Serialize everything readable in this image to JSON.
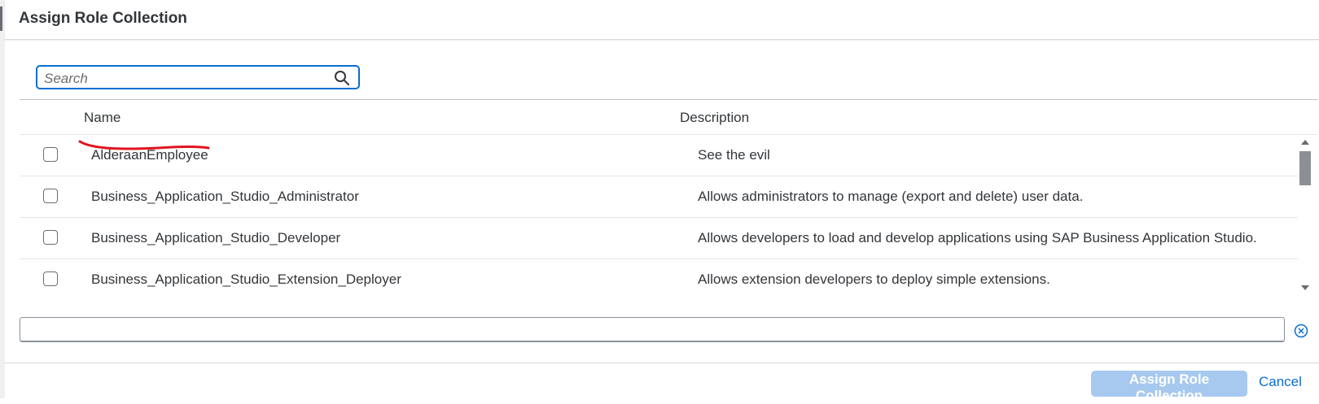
{
  "dialog": {
    "title": "Assign Role Collection"
  },
  "search": {
    "placeholder": "Search",
    "value": "",
    "icon": "search-icon"
  },
  "table": {
    "columns": [
      "Name",
      "Description"
    ],
    "rows": [
      {
        "name": "AlderaanEmployee",
        "description": "See the evil",
        "checked": false
      },
      {
        "name": "Business_Application_Studio_Administrator",
        "description": "Allows administrators to manage (export and delete) user data.",
        "checked": false
      },
      {
        "name": "Business_Application_Studio_Developer",
        "description": "Allows developers to load and develop applications using SAP Business Application Studio.",
        "checked": false
      },
      {
        "name": "Business_Application_Studio_Extension_Deployer",
        "description": "Allows extension developers to deploy simple extensions.",
        "checked": false
      }
    ]
  },
  "annotation": {
    "color": "#e0141e"
  },
  "footer": {
    "assign_label": "Assign Role Collection",
    "cancel_label": "Cancel"
  },
  "colors": {
    "accent": "#0a6ed1",
    "disabled_button": "#a7c9ef"
  }
}
